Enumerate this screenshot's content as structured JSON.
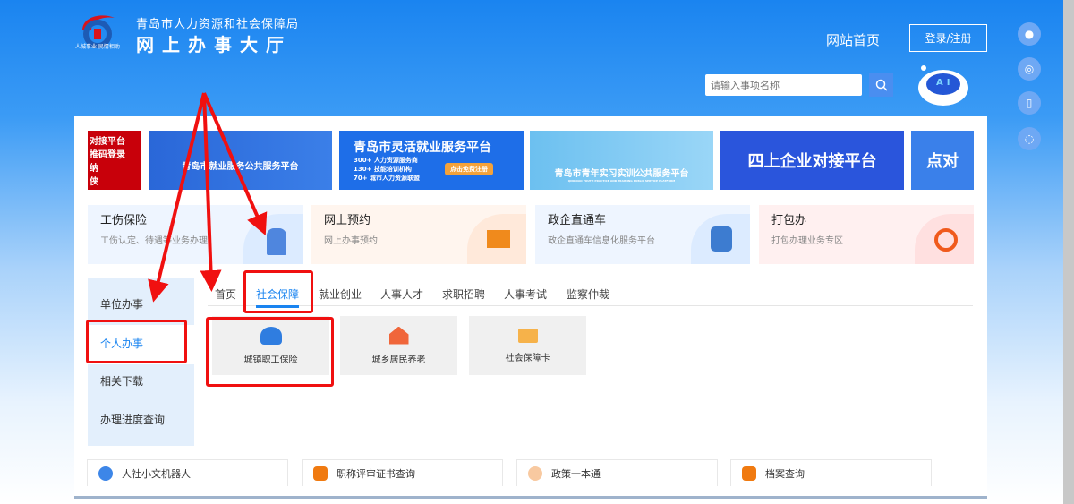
{
  "header": {
    "org_name": "青岛市人力资源和社会保障局",
    "hall_name": "网上办事大厅",
    "slogan": "人城事业 民情相助",
    "home_link": "网站首页",
    "login_button": "登录/注册",
    "search_placeholder": "请输入事项名称",
    "robot_label": "AI"
  },
  "side_icons": [
    "wechat-icon",
    "weibo-icon",
    "mobile-icon",
    "accessibility-icon"
  ],
  "banners": [
    {
      "title": "对接平台",
      "lines": [
        "推码登录",
        "纳",
        "侠"
      ],
      "color": "#c8000a"
    },
    {
      "title": "青岛市就业服务公共服务平台",
      "lines": [],
      "color": "#2a67d8"
    },
    {
      "title": "青岛市灵活就业服务平台",
      "lines": [
        "300+ 人力资源服务商",
        "130+ 技能培训机构",
        "70+ 城市人力资源联盟"
      ],
      "button": "点击免费注册",
      "color": "#1e6ee8"
    },
    {
      "title": "青岛市青年实习实训公共服务平台",
      "lines": [
        "QINGDAO YOUTH PRACTICE AND TRAINING PUBLIC SERVICE PLATFORM"
      ],
      "color": "#5fb3ec"
    },
    {
      "title": "四上企业对接平台",
      "lines": [],
      "color": "#2a55dc"
    },
    {
      "title": "点对",
      "lines": [],
      "color": "#3a80ea"
    }
  ],
  "service_cards": [
    {
      "title": "工伤保险",
      "subtitle": "工伤认定、待遇等业务办理",
      "icon": "injured-person-icon",
      "bg": "#eef5ff"
    },
    {
      "title": "网上预约",
      "subtitle": "网上办事预约",
      "icon": "chat-icon",
      "bg": "#fff5ee"
    },
    {
      "title": "政企直通车",
      "subtitle": "政企直通车信息化服务平台",
      "icon": "train-icon",
      "bg": "#eef5ff"
    },
    {
      "title": "打包办",
      "subtitle": "打包办理业务专区",
      "icon": "alarm-clock-icon",
      "bg": "#fff0f0"
    }
  ],
  "left_nav": [
    {
      "label": "单位办事"
    },
    {
      "label": "个人办事",
      "active": true
    },
    {
      "label": "相关下载"
    },
    {
      "label": "办理进度查询"
    }
  ],
  "tabs": [
    {
      "label": "首页"
    },
    {
      "label": "社会保障",
      "active": true
    },
    {
      "label": "就业创业"
    },
    {
      "label": "人事人才"
    },
    {
      "label": "求职招聘"
    },
    {
      "label": "人事考试"
    },
    {
      "label": "监察仲裁"
    }
  ],
  "tiles": [
    {
      "label": "城镇职工保险",
      "icon": "medical-hand-icon"
    },
    {
      "label": "城乡居民养老",
      "icon": "house-icon"
    },
    {
      "label": "社会保障卡",
      "icon": "id-card-icon"
    }
  ],
  "quick_links": [
    {
      "label": "人社小文机器人",
      "icon": "robot-icon"
    },
    {
      "label": "职称评审证书查询",
      "icon": "certificate-icon"
    },
    {
      "label": "政策一本通",
      "icon": "policy-icon"
    },
    {
      "label": "档案查询",
      "icon": "archive-icon"
    }
  ],
  "colors": {
    "accent": "#1a84f0",
    "annotation": "#f01010",
    "tab_active": "#1a84f0"
  }
}
